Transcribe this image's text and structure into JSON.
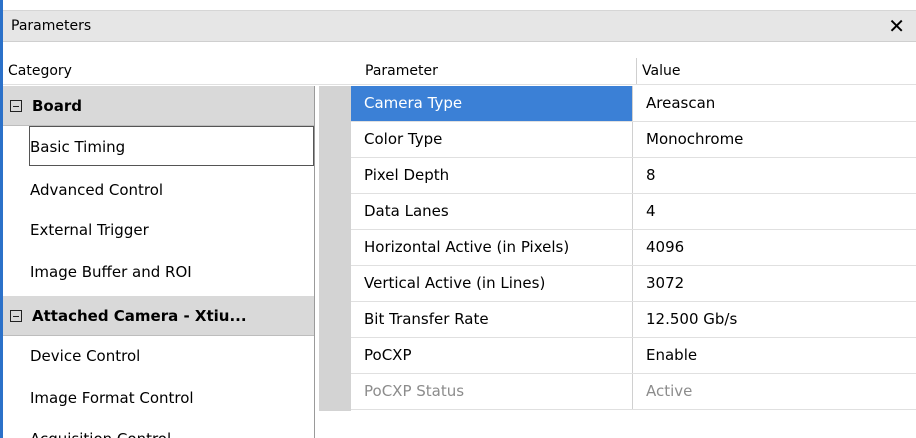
{
  "window": {
    "title": "Parameters",
    "close_glyph": "✕"
  },
  "headers": {
    "category": "Category",
    "parameter": "Parameter",
    "value": "Value"
  },
  "categories": [
    {
      "label": "Board",
      "type": "group"
    },
    {
      "label": "Basic Timing",
      "type": "child",
      "selected": true
    },
    {
      "label": "Advanced Control",
      "type": "child"
    },
    {
      "label": "External Trigger",
      "type": "child"
    },
    {
      "label": "Image Buffer and ROI",
      "type": "child"
    },
    {
      "label": "Attached Camera - Xtiu...",
      "type": "group"
    },
    {
      "label": "Device Control",
      "type": "child"
    },
    {
      "label": "Image Format Control",
      "type": "child"
    },
    {
      "label": "Acquisition Control",
      "type": "child"
    }
  ],
  "parameters": [
    {
      "name": "Camera Type",
      "value": "Areascan",
      "selected": true
    },
    {
      "name": "Color Type",
      "value": "Monochrome"
    },
    {
      "name": "Pixel Depth",
      "value": "8"
    },
    {
      "name": "Data Lanes",
      "value": "4"
    },
    {
      "name": "Horizontal Active (in Pixels)",
      "value": "4096"
    },
    {
      "name": "Vertical Active (in Lines)",
      "value": "3072"
    },
    {
      "name": "Bit Transfer Rate",
      "value": "12.500 Gb/s"
    },
    {
      "name": "PoCXP",
      "value": "Enable"
    },
    {
      "name": "PoCXP Status",
      "value": "Active",
      "disabled": true
    }
  ],
  "colors": {
    "selection": "#3b80d6",
    "group_bg": "#d9d9d9",
    "accent_rule": "#2b71c9"
  }
}
